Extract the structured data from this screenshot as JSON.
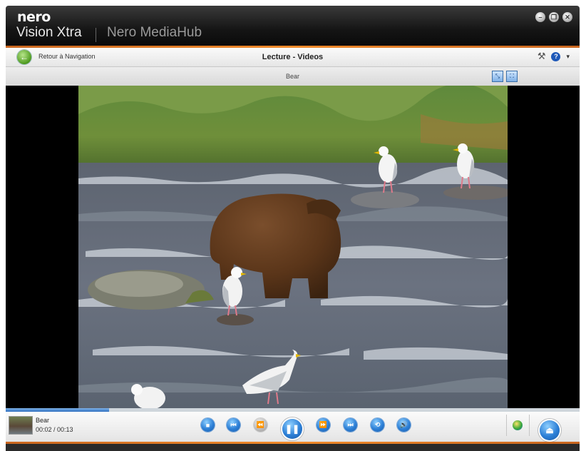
{
  "app": {
    "logo_text": "nero",
    "product_name": "Vision Xtra",
    "secondary_title": "Nero MediaHub",
    "window_controls": [
      {
        "name": "minimize-icon",
        "glyph": "–"
      },
      {
        "name": "restore-icon",
        "glyph": "❐"
      },
      {
        "name": "close-icon",
        "glyph": "✕"
      }
    ]
  },
  "nav": {
    "back_label": "Retour à Navigation",
    "back_icon": "arrow-left-icon",
    "page_title": "Lecture - Videos",
    "tools_icon": "hammer-icon",
    "help_icon": "help-icon",
    "help_glyph": "?",
    "help_dropdown_glyph": "▾"
  },
  "subbar": {
    "video_name": "Bear",
    "fit_view_icon": "fit-to-window-icon",
    "fullscreen_icon": "fullscreen-icon"
  },
  "player": {
    "clip_name": "Bear",
    "time_display": "00:02 / 00:13",
    "progress_fraction": 0.18,
    "buttons": [
      {
        "name": "stop-button",
        "glyph": "■",
        "enabled": true
      },
      {
        "name": "previous-button",
        "glyph": "⏮",
        "enabled": true
      },
      {
        "name": "rewind-button",
        "glyph": "⏪",
        "enabled": false
      },
      {
        "name": "pause-button",
        "glyph": "❚❚",
        "enabled": true,
        "primary": true
      },
      {
        "name": "fast-forward-button",
        "glyph": "⏩",
        "enabled": true
      },
      {
        "name": "next-button",
        "glyph": "⏭",
        "enabled": true
      },
      {
        "name": "repeat-button",
        "glyph": "⟲",
        "enabled": true
      },
      {
        "name": "volume-button",
        "glyph": "🔊",
        "enabled": true
      }
    ],
    "online_icon": "globe-icon",
    "eject_glyph": "⏏"
  },
  "colors": {
    "accent_orange": "#f08a2a",
    "button_blue": "#2c7fd6",
    "titlebar_dark": "#151515"
  }
}
